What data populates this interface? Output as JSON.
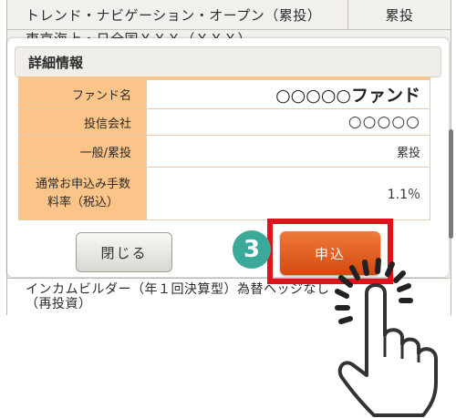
{
  "background_list": {
    "rows": [
      {
        "name": "トレンド・ナビゲーション・オープン（累投）",
        "type": "累投"
      },
      {
        "name": "東京海上・日全国ＸＸＸ（ＸＸＸ）",
        "type": ""
      },
      {
        "name": "インカムビルダー（年１回決算型）為替ヘッジなし",
        "name2": "（再投資）",
        "type": ""
      }
    ]
  },
  "modal": {
    "header": "詳細情報",
    "rows": [
      {
        "label": "ファンド名",
        "value": "○○○○○ファンド"
      },
      {
        "label": "投信会社",
        "value": "○○○○○"
      },
      {
        "label": "一般/累投",
        "value": "累投"
      },
      {
        "label_line1": "通常お申込み手数",
        "label_line2": "料率（税込）",
        "value": "1.1％"
      }
    ],
    "close_label": "閉じる",
    "apply_label": "申込"
  },
  "annotation": {
    "step_number": "3"
  },
  "colors": {
    "label_bg": "#fbc488",
    "apply_button": "#e05a1e",
    "highlight": "#e0121a",
    "step_badge": "#3aa99a"
  },
  "icons": {
    "tap_hand": "hand-tap-icon"
  }
}
